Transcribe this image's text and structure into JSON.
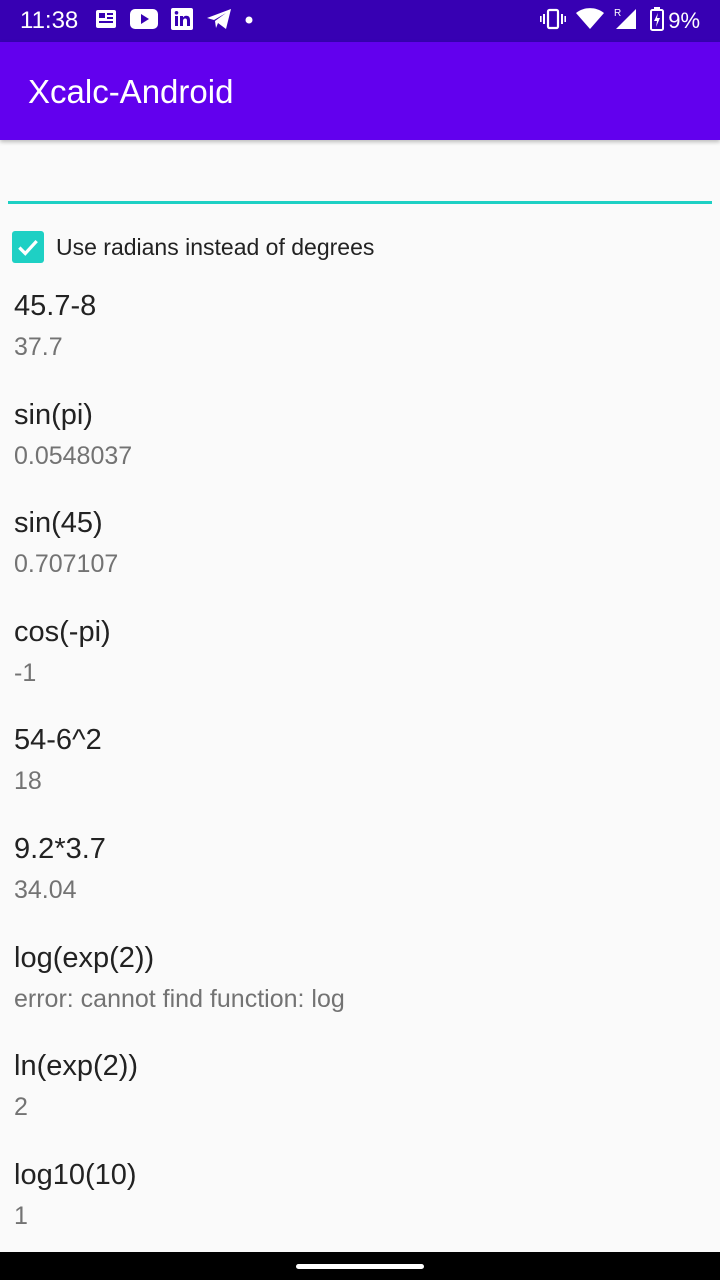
{
  "status_bar": {
    "time": "11:38",
    "battery": "9%",
    "left_icons": [
      "news-icon",
      "youtube-icon",
      "linkedin-icon",
      "telegram-icon",
      "dot-icon"
    ],
    "right_icons": [
      "vibrate-icon",
      "wifi-icon",
      "signal-icon",
      "battery-icon"
    ],
    "signal_roaming": "R"
  },
  "app_bar": {
    "title": "Xcalc-Android",
    "color": "#6200ee"
  },
  "input": {
    "value": "",
    "accent": "#1ed0c4"
  },
  "radians_option": {
    "label": "Use radians instead of degrees",
    "checked": true
  },
  "history": [
    {
      "expr": "45.7-8",
      "result": "37.7"
    },
    {
      "expr": "sin(pi)",
      "result": "0.0548037"
    },
    {
      "expr": "sin(45)",
      "result": "0.707107"
    },
    {
      "expr": "cos(-pi)",
      "result": "-1"
    },
    {
      "expr": "54-6^2",
      "result": "18"
    },
    {
      "expr": "9.2*3.7",
      "result": "34.04"
    },
    {
      "expr": "log(exp(2))",
      "result": "error: cannot find function: log"
    },
    {
      "expr": "ln(exp(2))",
      "result": "2"
    },
    {
      "expr": "log10(10)",
      "result": "1"
    }
  ]
}
